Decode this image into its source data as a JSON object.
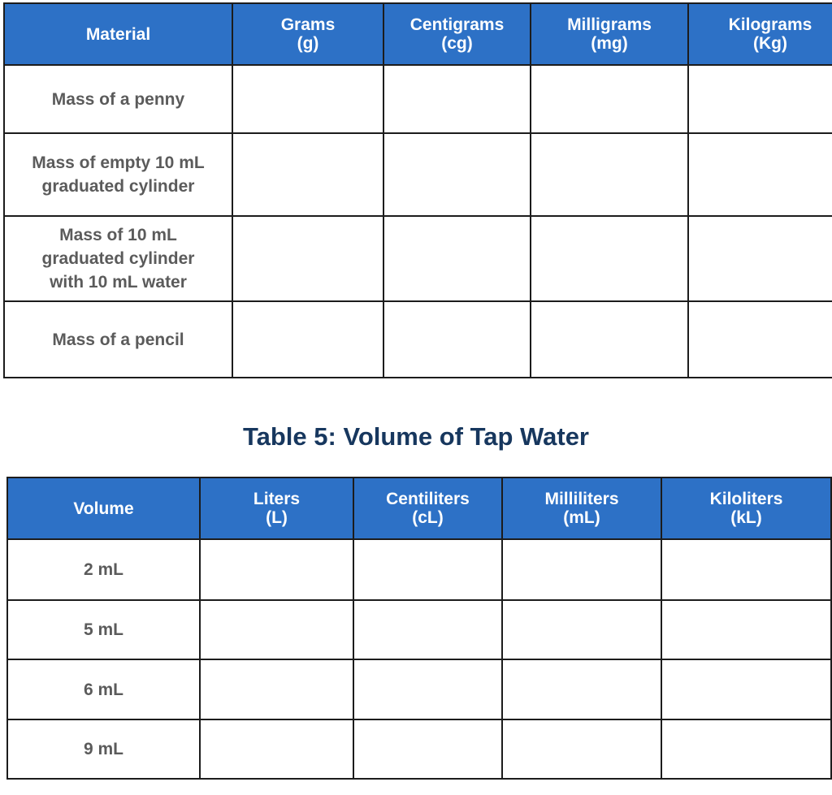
{
  "mass_table": {
    "headers": [
      {
        "name": "Material",
        "unit": ""
      },
      {
        "name": "Grams",
        "unit": "(g)"
      },
      {
        "name": "Centigrams",
        "unit": "(cg)"
      },
      {
        "name": "Milligrams",
        "unit": "(mg)"
      },
      {
        "name": "Kilograms",
        "unit": "(Kg)"
      }
    ],
    "rows": [
      {
        "label_lines": [
          "Mass of a penny"
        ],
        "values": [
          "",
          "",
          "",
          ""
        ]
      },
      {
        "label_lines": [
          "Mass of empty 10 mL",
          "graduated cylinder"
        ],
        "values": [
          "",
          "",
          "",
          ""
        ]
      },
      {
        "label_lines": [
          "Mass of 10 mL",
          "graduated cylinder",
          "with 10 mL water"
        ],
        "values": [
          "",
          "",
          "",
          ""
        ]
      },
      {
        "label_lines": [
          "Mass of a pencil"
        ],
        "values": [
          "",
          "",
          "",
          ""
        ]
      }
    ]
  },
  "volume_section": {
    "title": "Table 5: Volume of Tap Water"
  },
  "volume_table": {
    "headers": [
      {
        "name": "Volume",
        "unit": ""
      },
      {
        "name": "Liters",
        "unit": "(L)"
      },
      {
        "name": "Centiliters",
        "unit": "(cL)"
      },
      {
        "name": "Milliliters",
        "unit": "(mL)"
      },
      {
        "name": "Kiloliters",
        "unit": "(kL)"
      }
    ],
    "rows": [
      {
        "label_lines": [
          "2 mL"
        ],
        "values": [
          "",
          "",
          "",
          ""
        ]
      },
      {
        "label_lines": [
          "5 mL"
        ],
        "values": [
          "",
          "",
          "",
          ""
        ]
      },
      {
        "label_lines": [
          "6 mL"
        ],
        "values": [
          "",
          "",
          "",
          ""
        ]
      },
      {
        "label_lines": [
          "9 mL"
        ],
        "values": [
          "",
          "",
          "",
          ""
        ]
      }
    ]
  },
  "colors": {
    "header_bg": "#2d71c6",
    "header_text": "#ffffff",
    "label_text": "#5b5b5b",
    "title_text": "#17375e",
    "border": "#1c1c1c"
  }
}
